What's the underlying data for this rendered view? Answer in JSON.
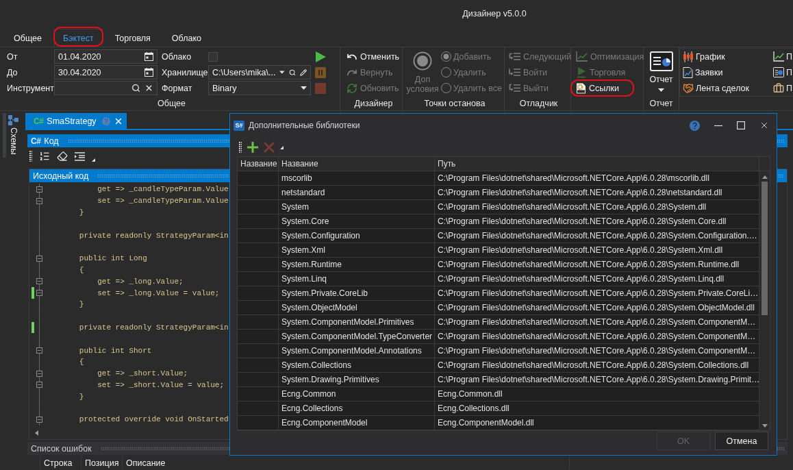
{
  "window": {
    "title": "Дизайнер v5.0.0"
  },
  "ribbon": {
    "tabs": [
      {
        "label": "Общее",
        "selected": false,
        "highlighted": false
      },
      {
        "label": "Бэктест",
        "selected": true,
        "highlighted": true
      },
      {
        "label": "Торговля",
        "selected": false,
        "highlighted": false
      },
      {
        "label": "Облако",
        "selected": false,
        "highlighted": false
      }
    ],
    "general_group": {
      "label": "Общее",
      "date_from": {
        "label": "От",
        "value": "01.04.2020"
      },
      "date_to": {
        "label": "До",
        "value": "30.04.2020"
      },
      "instrument": {
        "label": "Инструмент"
      },
      "cloud": {
        "label": "Облако",
        "checked": false
      },
      "storage": {
        "label": "Хранилище",
        "value": "C:\\Users\\mika\\..."
      },
      "format": {
        "label": "Формат",
        "value": "Binary"
      },
      "run_controls": [
        {
          "kind": "play",
          "disabled": false
        },
        {
          "kind": "pause",
          "disabled": true
        },
        {
          "kind": "stop",
          "disabled": true
        }
      ]
    },
    "designer_group": {
      "label": "Дизайнер",
      "buttons": [
        {
          "kind": "undo",
          "label": "Отменить",
          "disabled": false
        },
        {
          "kind": "redo",
          "label": "Вернуть",
          "disabled": true
        },
        {
          "kind": "refresh",
          "label": "Обновить",
          "disabled": true
        }
      ]
    },
    "breakpoints_group": {
      "label": "Точки останова",
      "big_button": {
        "label": "Доп условия",
        "disabled": true
      },
      "radios": [
        {
          "label": "Добавить",
          "selected": true,
          "disabled": true
        },
        {
          "label": "Удалить",
          "selected": false,
          "disabled": true
        },
        {
          "label": "Удалить все",
          "selected": false,
          "disabled": true
        }
      ]
    },
    "debugger_group": {
      "label": "Отладчик",
      "buttons": [
        {
          "kind": "step_next",
          "label": "Следующий",
          "disabled": true
        },
        {
          "kind": "step_into",
          "label": "Войти",
          "disabled": true
        },
        {
          "kind": "step_out",
          "label": "Выйти",
          "disabled": true
        }
      ]
    },
    "tools_group": {
      "buttons": [
        {
          "kind": "optimize",
          "label": "Оптимизация",
          "disabled": true,
          "highlighted": false
        },
        {
          "kind": "live",
          "label": "Торговля",
          "disabled": true,
          "highlighted": false
        },
        {
          "kind": "dll",
          "label": "Ссылки",
          "disabled": false,
          "highlighted": true
        }
      ]
    },
    "report_group": {
      "label": "Отчет",
      "button_label": "Отчет"
    },
    "panels_gallery": {
      "items": [
        {
          "kind": "candles",
          "label": "График"
        },
        {
          "kind": "orders",
          "label": "Заявки"
        },
        {
          "kind": "trades",
          "label": "Лента сделок"
        },
        {
          "kind": "chart",
          "label": "П"
        },
        {
          "kind": "report",
          "label": "П"
        },
        {
          "kind": "portfolio",
          "label": "П"
        }
      ]
    }
  },
  "sidebar": {
    "items": [
      {
        "label": "Схемы"
      }
    ]
  },
  "document_tab": {
    "logo": "C#",
    "title": "SmaStrategy"
  },
  "code_panel": {
    "logo": "C#",
    "title": "Код",
    "editor_title": "Исходный код",
    "lines": [
      {
        "kind": "code",
        "text": "            get => _candleTypeParam.Value",
        "fold": true,
        "changed": false
      },
      {
        "kind": "code",
        "text": "            set => _candleTypeParam.Value",
        "fold": true,
        "changed": false
      },
      {
        "kind": "code",
        "text": "        }",
        "fold": false,
        "changed": false
      },
      {
        "kind": "blank"
      },
      {
        "kind": "code",
        "text": "        private readonly StrategyParam<in",
        "fold": false,
        "changed": false
      },
      {
        "kind": "blank"
      },
      {
        "kind": "code",
        "text": "        public int Long",
        "fold": true,
        "changed": false
      },
      {
        "kind": "code",
        "text": "        {",
        "fold": false,
        "changed": false
      },
      {
        "kind": "code",
        "text": "            get => _long.Value;",
        "fold": true,
        "changed": false
      },
      {
        "kind": "code",
        "text": "            set => _long.Value = value;",
        "fold": true,
        "changed": true
      },
      {
        "kind": "code",
        "text": "        }",
        "fold": false,
        "changed": false
      },
      {
        "kind": "blank"
      },
      {
        "kind": "code",
        "text": "        private readonly StrategyParam<in",
        "fold": false,
        "changed": true
      },
      {
        "kind": "blank"
      },
      {
        "kind": "code",
        "text": "        public int Short",
        "fold": true,
        "changed": false
      },
      {
        "kind": "code",
        "text": "        {",
        "fold": false,
        "changed": false
      },
      {
        "kind": "code",
        "text": "            get => _short.Value;",
        "fold": true,
        "changed": false
      },
      {
        "kind": "code",
        "text": "            set => _short.Value = value;",
        "fold": true,
        "changed": false
      },
      {
        "kind": "code",
        "text": "        }",
        "fold": false,
        "changed": false
      },
      {
        "kind": "blank"
      },
      {
        "kind": "code",
        "text": "        protected override void OnStarted",
        "fold": true,
        "changed": false
      }
    ]
  },
  "error_list": {
    "title": "Список ошибок",
    "columns": [
      "Строка",
      "Позиция",
      "Описание"
    ]
  },
  "dialog": {
    "logo": "S#",
    "title": "Дополнительные библиотеки",
    "toolbar": [
      {
        "kind": "add",
        "disabled": false
      },
      {
        "kind": "remove",
        "disabled": true
      }
    ],
    "table": {
      "columns": [
        "Название",
        "Название",
        "Путь"
      ],
      "rows": [
        {
          "name": "mscorlib",
          "path": "C:\\Program Files\\dotnet\\shared\\Microsoft.NETCore.App\\6.0.28\\mscorlib.dll"
        },
        {
          "name": "netstandard",
          "path": "C:\\Program Files\\dotnet\\shared\\Microsoft.NETCore.App\\6.0.28\\netstandard.dll"
        },
        {
          "name": "System",
          "path": "C:\\Program Files\\dotnet\\shared\\Microsoft.NETCore.App\\6.0.28\\System.dll"
        },
        {
          "name": "System.Core",
          "path": "C:\\Program Files\\dotnet\\shared\\Microsoft.NETCore.App\\6.0.28\\System.Core.dll"
        },
        {
          "name": "System.Configuration",
          "path": "C:\\Program Files\\dotnet\\shared\\Microsoft.NETCore.App\\6.0.28\\System.Configuration.…"
        },
        {
          "name": "System.Xml",
          "path": "C:\\Program Files\\dotnet\\shared\\Microsoft.NETCore.App\\6.0.28\\System.Xml.dll"
        },
        {
          "name": "System.Runtime",
          "path": "C:\\Program Files\\dotnet\\shared\\Microsoft.NETCore.App\\6.0.28\\System.Runtime.dll"
        },
        {
          "name": "System.Linq",
          "path": "C:\\Program Files\\dotnet\\shared\\Microsoft.NETCore.App\\6.0.28\\System.Linq.dll"
        },
        {
          "name": "System.Private.CoreLib",
          "path": "C:\\Program Files\\dotnet\\shared\\Microsoft.NETCore.App\\6.0.28\\System.Private.CoreLi…"
        },
        {
          "name": "System.ObjectModel",
          "path": "C:\\Program Files\\dotnet\\shared\\Microsoft.NETCore.App\\6.0.28\\System.ObjectModel.dll"
        },
        {
          "name": "System.ComponentModel.Primitives",
          "path": "C:\\Program Files\\dotnet\\shared\\Microsoft.NETCore.App\\6.0.28\\System.ComponentM…"
        },
        {
          "name": "System.ComponentModel.TypeConverter",
          "path": "C:\\Program Files\\dotnet\\shared\\Microsoft.NETCore.App\\6.0.28\\System.ComponentM…"
        },
        {
          "name": "System.ComponentModel.Annotations",
          "path": "C:\\Program Files\\dotnet\\shared\\Microsoft.NETCore.App\\6.0.28\\System.ComponentM…"
        },
        {
          "name": "System.Collections",
          "path": "C:\\Program Files\\dotnet\\shared\\Microsoft.NETCore.App\\6.0.28\\System.Collections.dll"
        },
        {
          "name": "System.Drawing.Primitives",
          "path": "C:\\Program Files\\dotnet\\shared\\Microsoft.NETCore.App\\6.0.28\\System.Drawing.Primit…"
        },
        {
          "name": "Ecng.Common",
          "path": "Ecng.Common.dll"
        },
        {
          "name": "Ecng.Collections",
          "path": "Ecng.Collections.dll"
        },
        {
          "name": "Ecng.ComponentModel",
          "path": "Ecng.ComponentModel.dll"
        }
      ]
    },
    "buttons": [
      {
        "label": "OK",
        "disabled": true
      },
      {
        "label": "Отмена",
        "disabled": false
      }
    ]
  }
}
